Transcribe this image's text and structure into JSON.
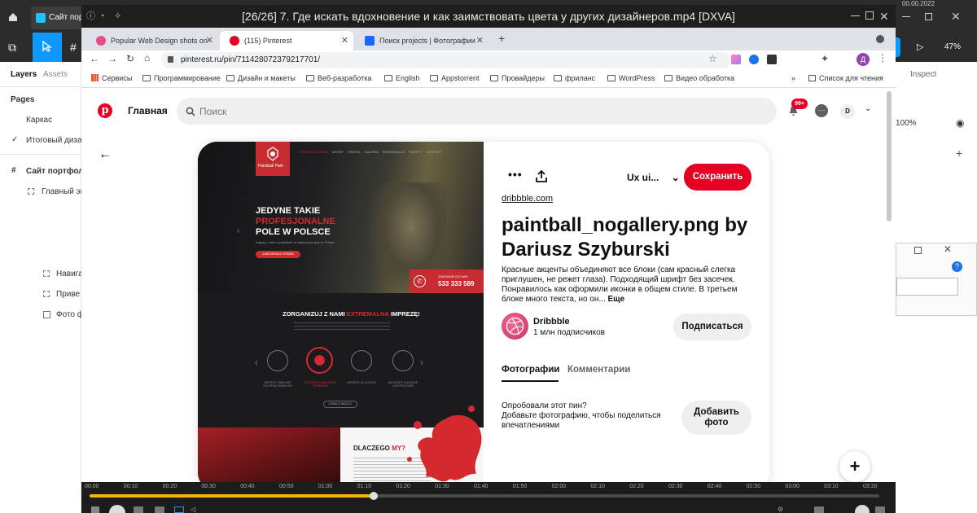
{
  "player": {
    "title": "[26/26] 7. Где искать вдохновение и как заимствовать цвета у других дизайнеров.mp4 [DXVA]",
    "timeline_ticks": [
      "00:00",
      "00:10",
      "00:20",
      "00:30",
      "00:40",
      "00:50",
      "01:00",
      "01:10",
      "01:20",
      "01:30",
      "01:40",
      "01:50",
      "02:00",
      "02:10",
      "02:20",
      "02:30",
      "02:40",
      "02:50",
      "03:00",
      "03:10",
      "03:20"
    ],
    "progress": 0.36
  },
  "figma": {
    "file_tab": "Сайт порт",
    "zoom": "47%",
    "layers_tab": "Layers",
    "assets_tab": "Assets",
    "pages_label": "Pages",
    "pages": [
      "Каркас",
      "Итоговый дизай"
    ],
    "layers": [
      "Сайт портфоли",
      "Главный эк",
      "Навига",
      "Приве",
      "Фото ф"
    ],
    "inspect_tab": "Inspect",
    "opacity": "100%",
    "date_fragment": "00.00.2022"
  },
  "browser": {
    "tabs": [
      {
        "label": "Popular Web Design shots on",
        "color": "#ea4c89"
      },
      {
        "label": "(115) Pinterest",
        "color": "#e60023"
      },
      {
        "label": "Поиск projects | Фотографии",
        "color": "#1769ff"
      }
    ],
    "url": "pinterest.ru/pin/711428072379217701/",
    "profile_initial": "Д",
    "bookmarks": [
      "Сервисы",
      "Программирование",
      "Дизайн и макеты",
      "Веб-разработка",
      "English",
      "Appstorrent",
      "Провайдеры",
      "фриланс",
      "WordPress",
      "Видео обработка"
    ],
    "reading_list": "Список для чтения"
  },
  "pinterest": {
    "nav_home": "Главная",
    "search_placeholder": "Поиск",
    "notifications_badge": "99+",
    "avatar_initial": "D",
    "board_name": "Ux ui...",
    "save_label": "Сохранить",
    "source_link": "dribbble.com",
    "pin_title": "paintball_nogallery.png by Dariusz Szyburski",
    "description": "Красные акценты объединяют все блоки (сам красный слегка приглушен, не режет глаза). Подходящий шрифт без засечек. Понравилось как оформили иконки в общем стиле. В третьем блоке много текста, но он...",
    "more_label": "Еще",
    "author_name": "Dribbble",
    "author_followers": "1 млн подписчиков",
    "follow_label": "Подписаться",
    "tab_photos": "Фотографии",
    "tab_comments": "Комментарии",
    "tried_title": "Опробовали этот пин?",
    "tried_text": "Добавьте фотографию, чтобы поделиться впечатлениями",
    "add_photo_label": "Добавить фото",
    "shot": {
      "menu": [
        "STRONA GŁÓWNA",
        "WSTĘP",
        "OFERTA",
        "GALERIA",
        "REZERWACJE",
        "PAKIETY",
        "KONTAKT"
      ],
      "logo_text": "Paintball Park",
      "hero_line1": "JEDYNE TAKIE",
      "hero_line2": "PROFESJONALNE",
      "hero_line3": "POLE W POLSCE",
      "hero_sub": "Zagraj z nami w paintball na najlepszym polu w Polsce",
      "hero_button": "ZAREZERWUJ TERMIN",
      "phone_label": "ZADZWOŃ DO NAS",
      "phone": "533 333 589",
      "org_title_1": "ZORGANIZUJ Z NAMI",
      "org_title_2": "EXTREMALNĄ",
      "org_title_3": "IMPREZĘ!",
      "icons": [
        "IMPREZY FIRMOWE DLA PRACOWNIKÓW",
        "WIECZÓR KAWALERSKI / PANIEŃSKI",
        "IMPREZY DLA SZKÓŁ",
        "MŁODZIEŻ KLUBOWE LUB PRACOWE"
      ],
      "more_button": "ZOBACZ WIĘCEJ",
      "why_1": "DLACZEGO",
      "why_2": "MY?"
    }
  },
  "colors": {
    "pinterest_red": "#e60023",
    "shot_red": "#d42a2f",
    "player_bg": "#1c1c1c",
    "progress": "#f2b705"
  }
}
